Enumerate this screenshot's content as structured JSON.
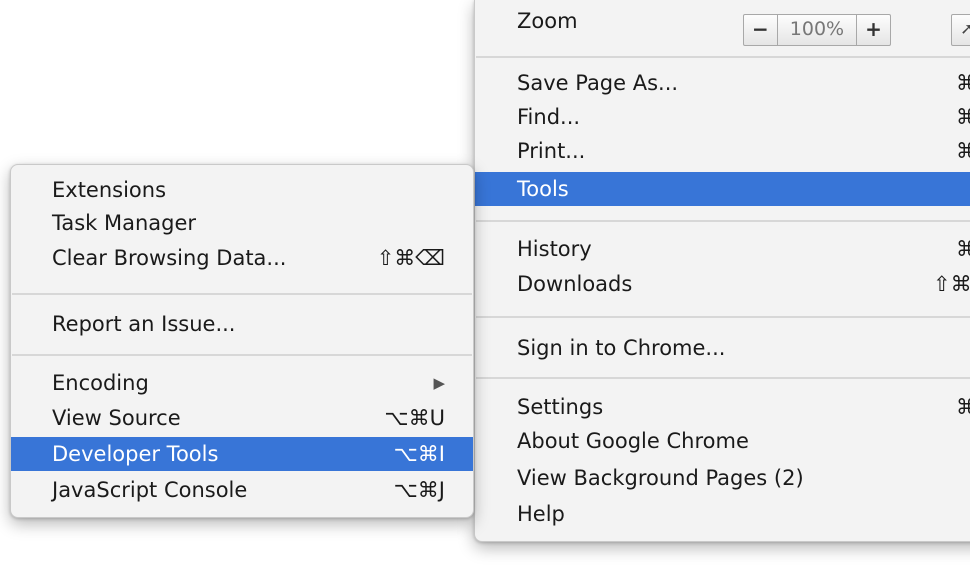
{
  "main_menu": {
    "zoom": {
      "label": "Zoom",
      "minus": "−",
      "value": "100%",
      "plus": "+",
      "fullscreen_icon": "fullscreen-arrow-icon"
    },
    "items": [
      {
        "label": "Save Page As...",
        "shortcut": "⌘"
      },
      {
        "label": "Find...",
        "shortcut": "⌘"
      },
      {
        "label": "Print...",
        "shortcut": "⌘"
      },
      {
        "label": "Tools",
        "selected": true
      },
      {
        "label": "History",
        "shortcut": "⌘"
      },
      {
        "label": "Downloads",
        "shortcut": "⇧⌘"
      },
      {
        "label": "Sign in to Chrome..."
      },
      {
        "label": "Settings",
        "shortcut": "⌘"
      },
      {
        "label": "About Google Chrome"
      },
      {
        "label": "View Background Pages (2)"
      },
      {
        "label": "Help"
      }
    ]
  },
  "tools_submenu": {
    "items": [
      {
        "label": "Extensions"
      },
      {
        "label": "Task Manager"
      },
      {
        "label": "Clear Browsing Data...",
        "shortcut": "⇧⌘⌫"
      },
      {
        "label": "Report an Issue..."
      },
      {
        "label": "Encoding",
        "shortcut": "▶"
      },
      {
        "label": "View Source",
        "shortcut": "⌥⌘U"
      },
      {
        "label": "Developer Tools",
        "shortcut": "⌥⌘I",
        "selected": true
      },
      {
        "label": "JavaScript Console",
        "shortcut": "⌥⌘J"
      }
    ]
  },
  "colors": {
    "selection": "#3875d7",
    "menu_bg": "#f3f3f3",
    "separator": "#d7d7d7"
  }
}
